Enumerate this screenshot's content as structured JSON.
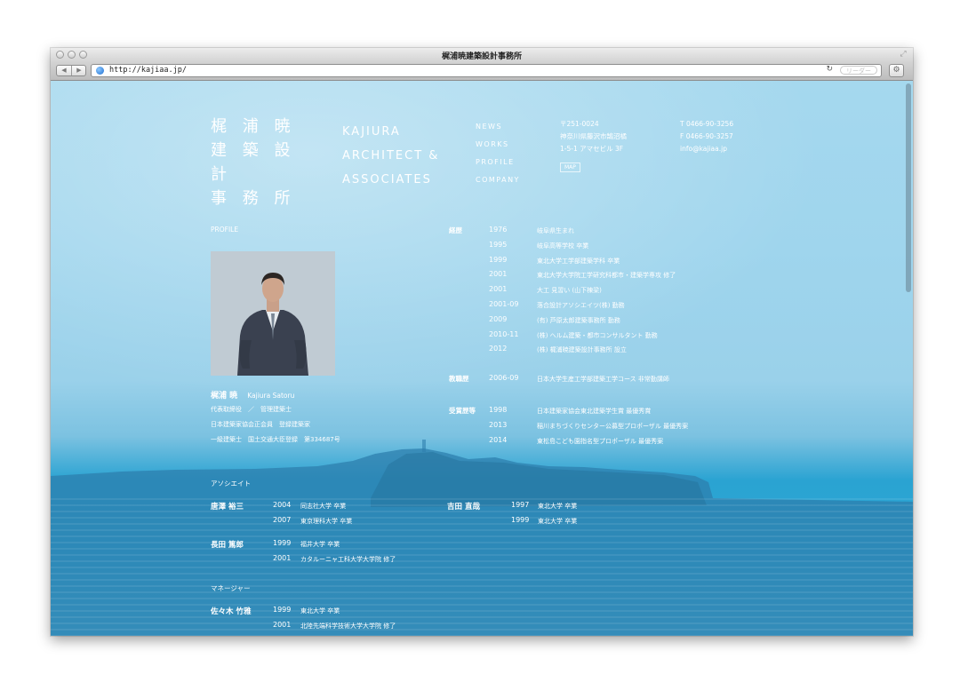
{
  "browser": {
    "title": "梶浦暁建築設計事務所",
    "url": "http://kajiaa.jp/",
    "reader_label": "リーダー"
  },
  "site": {
    "logo_jp": [
      "梶 浦 暁",
      "建 築 設 計",
      "事 務 所"
    ],
    "logo_en": [
      "KAJIURA",
      "ARCHITECT &",
      "ASSOCIATES"
    ],
    "nav": [
      "NEWS",
      "WORKS",
      "PROFILE",
      "COMPANY"
    ],
    "address": [
      "〒251-0024",
      "神奈川県藤沢市鵠沼橘",
      "1-5-1 アマセビル 3F"
    ],
    "map_label": "MAP",
    "contact": [
      "T 0466-90-3256",
      "F 0466-90-3257",
      "info@kajiaa.jp"
    ]
  },
  "profile": {
    "section_label": "PROFILE",
    "name_jp": "梶浦 暁",
    "name_en": "Kajiura Satoru",
    "info": [
      "代表取締役　／　管理建築士",
      "日本建築家協会正会員　登録建築家",
      "一級建築士　国土交通大臣登録　第334687号"
    ],
    "career_label": "経歴",
    "career": [
      {
        "year": "1976",
        "text": "岐阜県生まれ"
      },
      {
        "year": "1995",
        "text": "岐阜高等学校 卒業"
      },
      {
        "year": "1999",
        "text": "東北大学工学部建築学科 卒業"
      },
      {
        "year": "2001",
        "text": "東北大学大学院工学研究科都市・建築学専攻 修了"
      },
      {
        "year": "2001",
        "text": "大工 見習い (山下棟梁)"
      },
      {
        "year": "2001-09",
        "text": "落合設計アソシエイツ(株) 勤務"
      },
      {
        "year": "2009",
        "text": "(有) 芦原太郎建築事務所 勤務"
      },
      {
        "year": "2010-11",
        "text": "(株) ヘルム建築・都市コンサルタント 勤務"
      },
      {
        "year": "2012",
        "text": "(株) 梶浦暁建築設計事務所 設立"
      }
    ],
    "teaching_label": "教職歴",
    "teaching": [
      {
        "year": "2006-09",
        "text": "日本大学生産工学部建築工学コース 非常勤講師"
      }
    ],
    "awards_label": "受賞歴等",
    "awards": [
      {
        "year": "1998",
        "text": "日本建築家協会東北建築学生賞 最優秀賞"
      },
      {
        "year": "2013",
        "text": "稲川まちづくりセンター公募型プロポーザル 最優秀案"
      },
      {
        "year": "2014",
        "text": "東松島こども園指名型プロポーザル 最優秀案"
      }
    ]
  },
  "associates": {
    "label": "アソシエイト",
    "people": [
      {
        "name": "唐澤 裕三",
        "entries": [
          {
            "year": "2004",
            "text": "同志社大学 卒業"
          },
          {
            "year": "2007",
            "text": "東京理科大学 卒業"
          }
        ]
      },
      {
        "name": "吉田 直哉",
        "entries": [
          {
            "year": "1997",
            "text": "東北大学 卒業"
          },
          {
            "year": "1999",
            "text": "東北大学 卒業"
          }
        ]
      },
      {
        "name": "長田 篤郎",
        "entries": [
          {
            "year": "1999",
            "text": "福井大学 卒業"
          },
          {
            "year": "2001",
            "text": "カタルーニャ工科大学大学院 修了"
          }
        ]
      }
    ]
  },
  "managers": {
    "label": "マネージャー",
    "people": [
      {
        "name": "佐々木 竹雅",
        "entries": [
          {
            "year": "1999",
            "text": "東北大学 卒業"
          },
          {
            "year": "2001",
            "text": "北陸先端科学技術大学大学院 修了"
          }
        ]
      }
    ]
  }
}
